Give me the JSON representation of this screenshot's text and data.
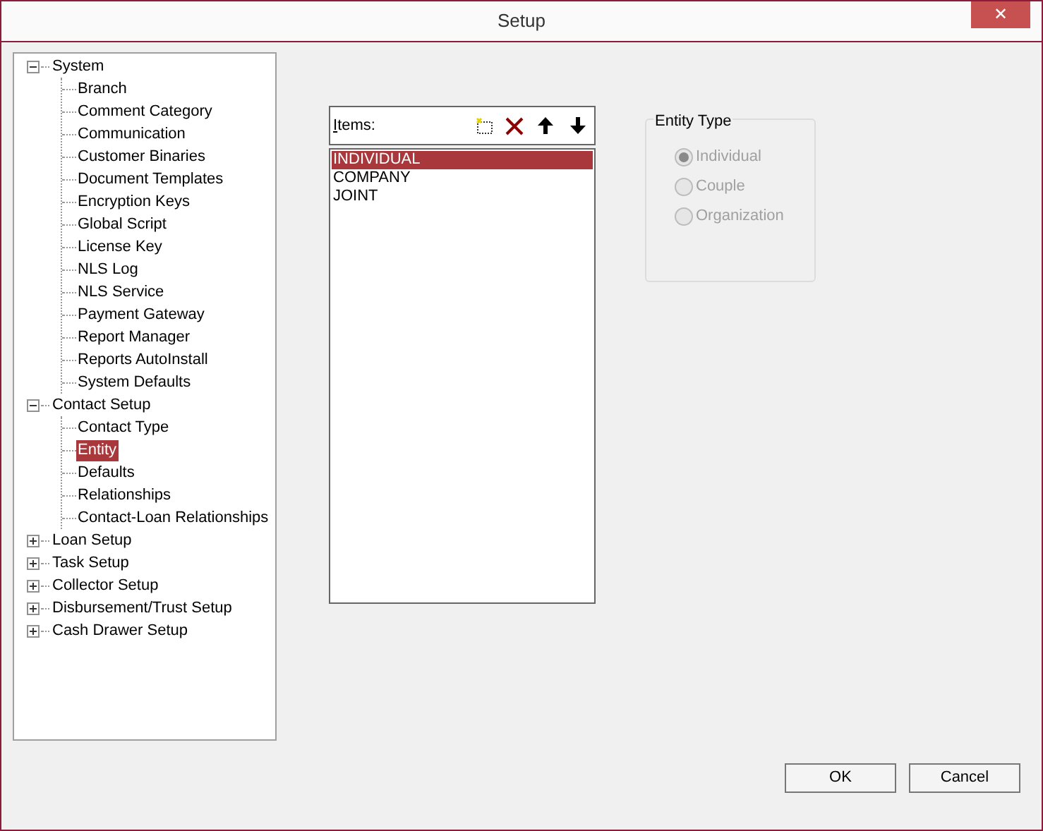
{
  "window": {
    "title": "Setup",
    "close": "✕"
  },
  "tree": [
    {
      "label": "System",
      "expanded": true,
      "selected": false,
      "children": [
        {
          "label": "Branch",
          "selected": false
        },
        {
          "label": "Comment Category",
          "selected": false
        },
        {
          "label": "Communication",
          "selected": false
        },
        {
          "label": "Customer Binaries",
          "selected": false
        },
        {
          "label": "Document Templates",
          "selected": false
        },
        {
          "label": "Encryption Keys",
          "selected": false
        },
        {
          "label": "Global Script",
          "selected": false
        },
        {
          "label": "License Key",
          "selected": false
        },
        {
          "label": "NLS Log",
          "selected": false
        },
        {
          "label": "NLS Service",
          "selected": false
        },
        {
          "label": "Payment Gateway",
          "selected": false
        },
        {
          "label": "Report Manager",
          "selected": false
        },
        {
          "label": "Reports AutoInstall",
          "selected": false
        },
        {
          "label": "System Defaults",
          "selected": false
        }
      ]
    },
    {
      "label": "Contact Setup",
      "expanded": true,
      "selected": false,
      "children": [
        {
          "label": "Contact Type",
          "selected": false
        },
        {
          "label": "Entity",
          "selected": true
        },
        {
          "label": "Defaults",
          "selected": false
        },
        {
          "label": "Relationships",
          "selected": false
        },
        {
          "label": "Contact-Loan Relationships",
          "selected": false
        }
      ]
    },
    {
      "label": "Loan Setup",
      "expanded": false,
      "selected": false
    },
    {
      "label": "Task Setup",
      "expanded": false,
      "selected": false
    },
    {
      "label": "Collector Setup",
      "expanded": false,
      "selected": false
    },
    {
      "label": "Disbursement/Trust Setup",
      "expanded": false,
      "selected": false
    },
    {
      "label": "Cash Drawer Setup",
      "expanded": false,
      "selected": false
    }
  ],
  "items": {
    "label": "Items:",
    "list": [
      {
        "label": "INDIVIDUAL",
        "selected": true
      },
      {
        "label": "COMPANY",
        "selected": false
      },
      {
        "label": "JOINT",
        "selected": false
      }
    ]
  },
  "entity_type": {
    "title": "Entity Type",
    "disabled": true,
    "options": [
      {
        "label": "Individual",
        "selected": true
      },
      {
        "label": "Couple",
        "selected": false
      },
      {
        "label": "Organization",
        "selected": false
      }
    ]
  },
  "buttons": [
    "OK",
    "Cancel"
  ]
}
